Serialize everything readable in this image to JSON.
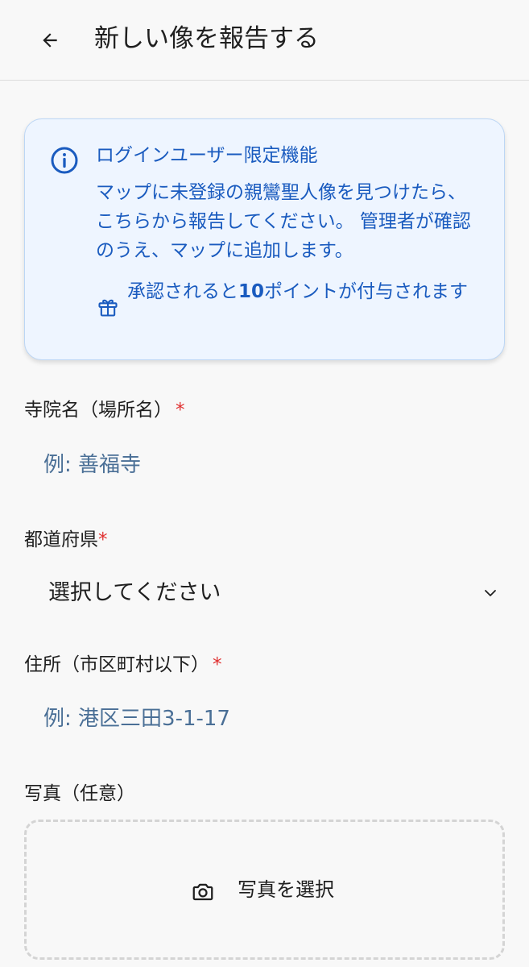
{
  "header": {
    "title": "新しい像を報告する",
    "back_icon": "arrow-left-icon"
  },
  "info": {
    "icon": "info-circle-icon",
    "title": "ログインユーザー限定機能",
    "body": "マップに未登録の親鸞聖人像を見つけたら、こちらから報告してください。 管理者が確認のうえ、マップに追加します。",
    "reward_icon": "gift-icon",
    "reward_prefix": "承認されると",
    "reward_points": "10",
    "reward_suffix": "ポイントが付与されます"
  },
  "form": {
    "temple": {
      "label": "寺院名（場所名）",
      "required": "*",
      "placeholder": "例: 善福寺"
    },
    "prefecture": {
      "label": "都道府県",
      "required": "*",
      "selected": "選択してください",
      "icon": "chevron-down-icon"
    },
    "address": {
      "label": "住所（市区町村以下）",
      "required": "*",
      "placeholder": "例: 港区三田3-1-17"
    },
    "photo": {
      "label": "写真（任意）",
      "button_label": "写真を選択",
      "icon": "camera-icon"
    }
  },
  "colors": {
    "accent": "#1a5bbf",
    "required": "#e03030",
    "card_background": "#eef5ff",
    "placeholder": "#4a6f96"
  }
}
